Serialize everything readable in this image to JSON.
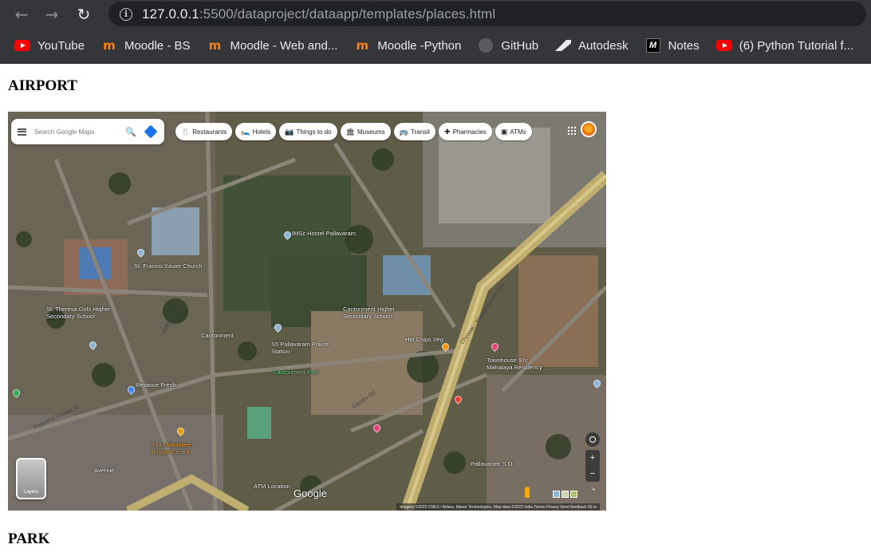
{
  "browser": {
    "url_host": "127.0.0.1",
    "url_rest": ":5500/dataproject/dataapp/templates/places.html",
    "bookmarks": [
      {
        "label": "YouTube",
        "icon": "youtube-icon"
      },
      {
        "label": "Moodle - BS",
        "icon": "moodle-icon"
      },
      {
        "label": "Moodle - Web and...",
        "icon": "moodle-icon"
      },
      {
        "label": "Moodle -Python",
        "icon": "moodle-icon"
      },
      {
        "label": "GitHub",
        "icon": "github-icon"
      },
      {
        "label": "Autodesk",
        "icon": "autodesk-icon"
      },
      {
        "label": "Notes",
        "icon": "notes-icon"
      },
      {
        "label": "(6) Python Tutorial f...",
        "icon": "youtube-icon"
      }
    ]
  },
  "page": {
    "heading1": "AIRPORT",
    "heading2": "PARK"
  },
  "map": {
    "search_placeholder": "Search Google Maps",
    "chips": [
      {
        "label": "Restaurants",
        "icon": "restaurant-icon"
      },
      {
        "label": "Hotels",
        "icon": "hotel-icon"
      },
      {
        "label": "Things to do",
        "icon": "things-to-do-icon"
      },
      {
        "label": "Museums",
        "icon": "museum-icon"
      },
      {
        "label": "Transit",
        "icon": "transit-icon"
      },
      {
        "label": "Pharmacies",
        "icon": "pharmacy-icon"
      },
      {
        "label": "ATMs",
        "icon": "atm-icon"
      }
    ],
    "layers_label": "Layers",
    "google_logo": "Google",
    "attribution": "Imagery ©2023 CNES / Airbus, Maxar Technologies, Map data ©2023   India   Terms   Privacy   Send feedback   50 m",
    "zoom_in": "+",
    "zoom_out": "−",
    "labels": {
      "imsc_hostel": "IMSc Hostel Pallavaram",
      "st_francis": "St. Francis Xavier Church",
      "st_theresa": "St. Theresa Girls Higher\nSecondary School",
      "cantonment": "Cantonment",
      "cantonment_school": "Cantonment Higher\nSecondary School",
      "police_station": "S5 Pallavaram Police\nStation",
      "cantonment_park": "Cantonment Park",
      "hot_chips": "Hot Chips Veg",
      "townhouse": "Townhouse 97c\nMahalaya Residency",
      "reliance_fresh": "Reliance Fresh",
      "yaa_mohaideen": "Yaa Mohaideen\nBiryani Centre",
      "atm_location": "ATM Location",
      "pallavaram_so": "Pallavaram S.O",
      "avenue": "Avenue",
      "chennai_highway": "Chennai - Nagapattinam Hwy",
      "gandhi_rd": "Gandhi Rd",
      "rajendra_prasad": "Rajendra Prasad St",
      "ambedkar_rd": "Ambedkar Rd"
    }
  }
}
